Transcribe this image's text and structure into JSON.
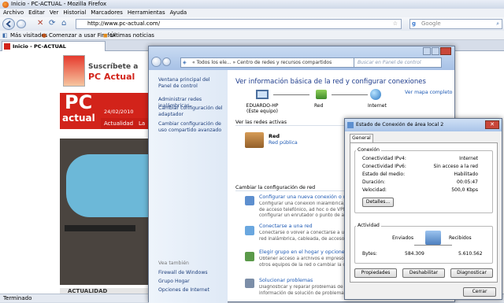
{
  "firefox": {
    "title": "Inicio - PC-ACTUAL - Mozilla Firefox",
    "menu": [
      "Archivo",
      "Editar",
      "Ver",
      "Historial",
      "Marcadores",
      "Herramientas",
      "Ayuda"
    ],
    "url": "http://www.pc-actual.com/",
    "search_placeholder": "Google",
    "bookmarks": [
      "Más visitados",
      "Comenzar a usar Firefox",
      "Últimas noticias"
    ],
    "tab": "Inicio - PC-ACTUAL",
    "status": "Terminado"
  },
  "site": {
    "logo_top": "PC",
    "logo_bottom": "actual",
    "subscribe": "Suscríbete a",
    "brand": "PC Actual",
    "date": "24/02/2010",
    "nav_item": "Actualidad",
    "nav_item2": "La",
    "section": "ACTUALIDAD"
  },
  "network_center": {
    "breadcrumb": "« Todos los ele... » Centro de redes y recursos compartidos",
    "search_placeholder": "Buscar en Panel de control",
    "sidebar_top": [
      "Ventana principal del Panel de control",
      "Administrar redes inalámbricas",
      "Cambiar configuración del adaptador",
      "Cambiar configuración de uso compartido avanzado"
    ],
    "see_also": "Vea también",
    "sidebar_bottom": [
      "Firewall de Windows",
      "Grupo Hogar",
      "Opciones de Internet"
    ],
    "heading": "Ver información básica de la red y configurar conexiones",
    "map_link": "Ver mapa completo",
    "nodes": [
      {
        "label": "EDUARDO-HP",
        "sub": "(Este equipo)"
      },
      {
        "label": "Red",
        "sub": ""
      },
      {
        "label": "Internet",
        "sub": ""
      }
    ],
    "active_label": "Ver las redes activas",
    "network_name": "Red",
    "network_type": "Red pública",
    "change_label": "Cambiar la configuración de red",
    "tasks": [
      {
        "title": "Configurar una nueva conexión o red",
        "desc": "Configurar una conexión inalámbrica, de banda ancha, de acceso telefónico, ad hoc o de VPN; o bien configurar un enrutador o punto de acceso."
      },
      {
        "title": "Conectarse a una red",
        "desc": "Conectarse o volver a conectarse a una conexión de red inalámbrica, cableada, de acceso telefónico o VPN."
      },
      {
        "title": "Elegir grupo en el hogar y opciones de uso compartido",
        "desc": "Obtener acceso a archivos e impresoras ubicados en otros equipos de la red o cambiar la configuración de uso compartido."
      },
      {
        "title": "Solucionar problemas",
        "desc": "Diagnosticar y reparar problemas de red u obtener información de solución de problemas."
      }
    ]
  },
  "status_dialog": {
    "title": "Estado de Conexión de área local 2",
    "tab": "General",
    "conn_group": "Conexión",
    "rows": [
      {
        "label": "Conectividad IPv4:",
        "value": "Internet"
      },
      {
        "label": "Conectividad IPv6:",
        "value": "Sin acceso a la red"
      },
      {
        "label": "Estado del medio:",
        "value": "Habilitado"
      },
      {
        "label": "Duración:",
        "value": "00:05:47"
      },
      {
        "label": "Velocidad:",
        "value": "500,0 Kbps"
      }
    ],
    "details_button": "Detalles...",
    "activity_group": "Actividad",
    "sent_label": "Enviados",
    "received_label": "Recibidos",
    "bytes_label": "Bytes:",
    "bytes_sent": "584.309",
    "bytes_received": "5.610.562",
    "buttons": [
      "Propiedades",
      "Deshabilitar",
      "Diagnosticar"
    ],
    "close_button": "Cerrar"
  }
}
